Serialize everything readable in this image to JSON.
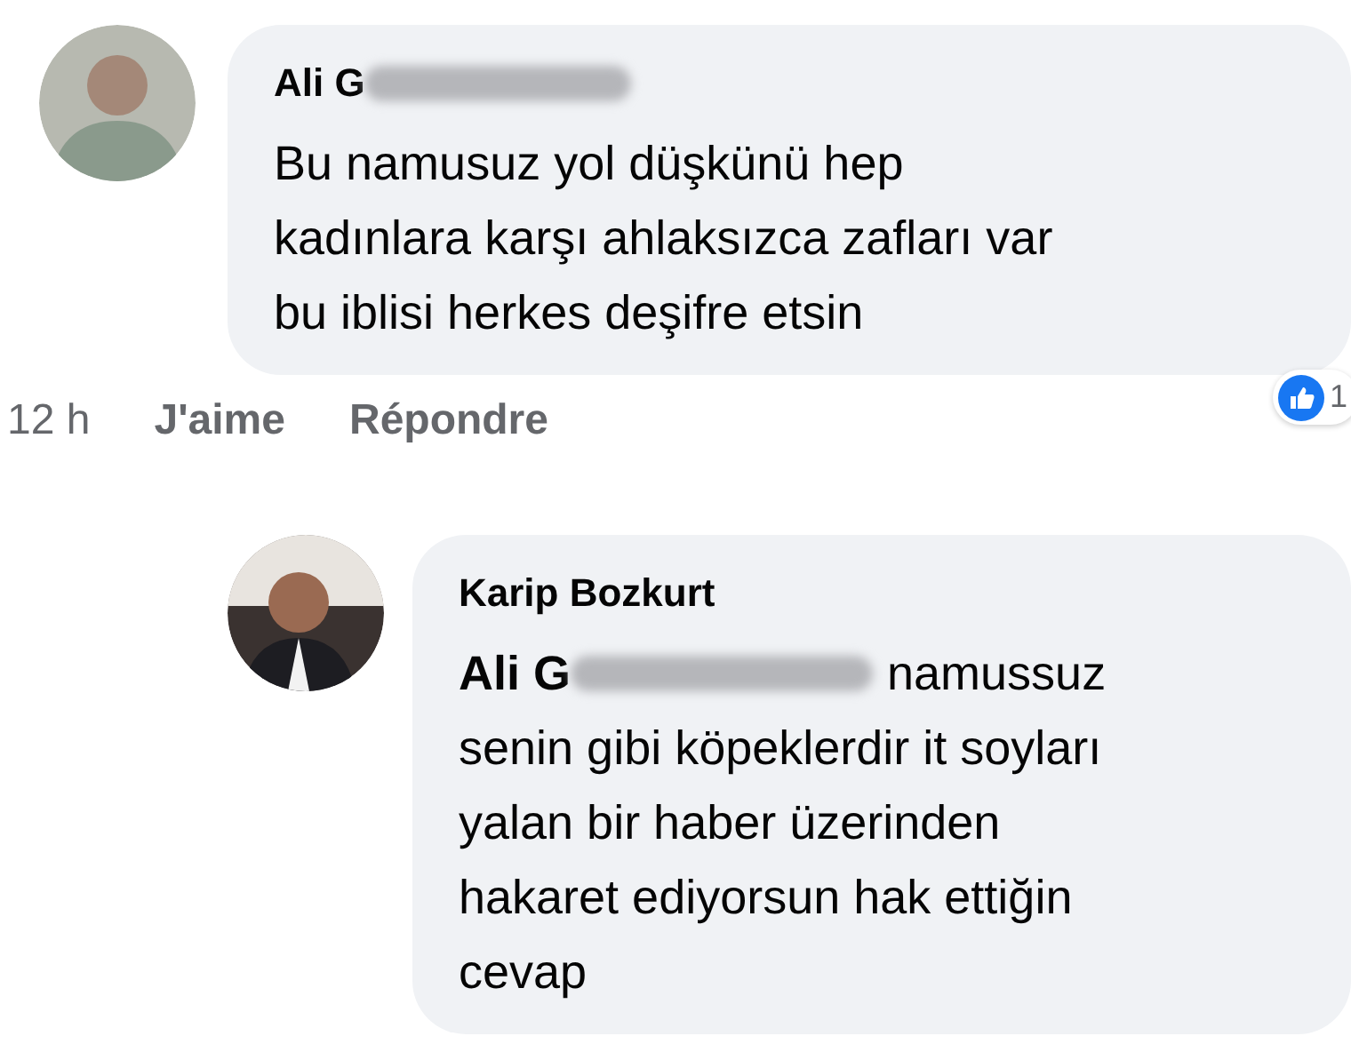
{
  "comments": [
    {
      "author": "Ali G",
      "author_redacted": true,
      "text": "Bu namusuz yol düşkünü hep\nkadınlara karşı ahlaksızca zafları var\nbu iblisi herkes deşifre etsin",
      "time": "12 h",
      "actions": [
        "J'aime",
        "Répondre"
      ],
      "reaction_count": "1",
      "reply": false
    },
    {
      "author": "Karip Bozkurt",
      "author_redacted": false,
      "mention": "Ali G",
      "mention_redacted": true,
      "mention_line_text": "namussuz",
      "text": "senin gibi köpeklerdir it soyları\nyalan bir haber üzerinden\nhakaret ediyorsun hak ettiğin\ncevap",
      "reply": true
    }
  ]
}
